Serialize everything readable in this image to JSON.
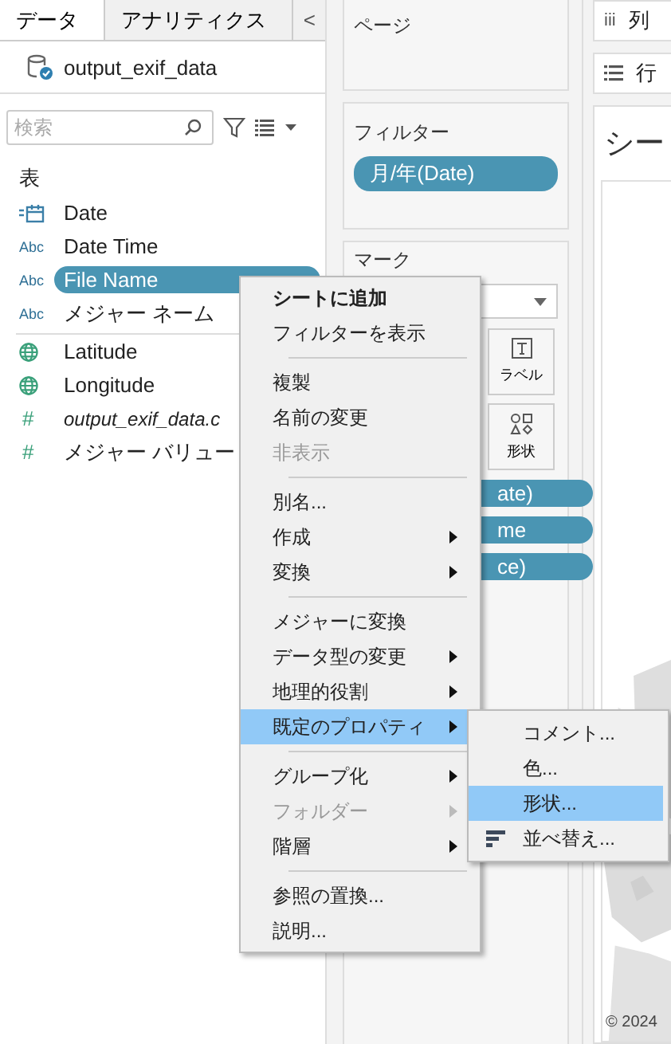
{
  "tabs": [
    {
      "label": "データ",
      "selected": true
    },
    {
      "label": "アナリティクス",
      "selected": false
    }
  ],
  "collapse_button": "<",
  "data_source": "output_exif_data",
  "search": {
    "placeholder": "検索"
  },
  "section_title": "表",
  "fields": [
    {
      "kind": "date",
      "name": "Date",
      "selected": false,
      "italic": false,
      "divider_before": false
    },
    {
      "kind": "string",
      "icon_text": "Abc",
      "name": "Date Time",
      "selected": false,
      "italic": false,
      "divider_before": false
    },
    {
      "kind": "string",
      "icon_text": "Abc",
      "name": "File Name",
      "selected": true,
      "italic": false,
      "divider_before": false
    },
    {
      "kind": "string",
      "icon_text": "Abc",
      "name": "メジャー ネーム",
      "selected": false,
      "italic": false,
      "divider_before": false
    },
    {
      "kind": "geo",
      "name": "Latitude",
      "selected": false,
      "italic": false,
      "divider_before": true
    },
    {
      "kind": "geo",
      "name": "Longitude",
      "selected": false,
      "italic": false,
      "divider_before": false
    },
    {
      "kind": "number",
      "icon_text": "#",
      "name": "output_exif_data.c",
      "selected": false,
      "italic": true,
      "divider_before": false
    },
    {
      "kind": "number",
      "icon_text": "#",
      "name": "メジャー バリュー",
      "selected": false,
      "italic": false,
      "divider_before": false
    }
  ],
  "pages_card": {
    "title": "ページ"
  },
  "filters_card": {
    "title": "フィルター",
    "pills": [
      "月/年(Date)"
    ]
  },
  "marks_card": {
    "title": "マーク",
    "buttons": [
      {
        "kind": "label",
        "label": "ラベル"
      },
      {
        "kind": "shape",
        "label": "形状"
      }
    ],
    "pills": [
      "ate)",
      "me",
      "ce)"
    ]
  },
  "columns_shelf": {
    "icon": "iii",
    "label": "列"
  },
  "rows_shelf": {
    "label": "行"
  },
  "sheet": {
    "title": "シー",
    "copyright": "© 2024"
  },
  "context_menu": [
    {
      "kind": "item",
      "label": "シートに追加",
      "bold": true,
      "disabled": false,
      "submenu": false,
      "selected": false
    },
    {
      "kind": "item",
      "label": "フィルターを表示",
      "bold": false,
      "disabled": false,
      "submenu": false,
      "selected": false
    },
    {
      "kind": "separator"
    },
    {
      "kind": "item",
      "label": "複製",
      "bold": false,
      "disabled": false,
      "submenu": false,
      "selected": false
    },
    {
      "kind": "item",
      "label": "名前の変更",
      "bold": false,
      "disabled": false,
      "submenu": false,
      "selected": false
    },
    {
      "kind": "item",
      "label": "非表示",
      "bold": false,
      "disabled": true,
      "submenu": false,
      "selected": false
    },
    {
      "kind": "separator"
    },
    {
      "kind": "item",
      "label": "別名...",
      "bold": false,
      "disabled": false,
      "submenu": false,
      "selected": false
    },
    {
      "kind": "item",
      "label": "作成",
      "bold": false,
      "disabled": false,
      "submenu": true,
      "selected": false
    },
    {
      "kind": "item",
      "label": "変換",
      "bold": false,
      "disabled": false,
      "submenu": true,
      "selected": false
    },
    {
      "kind": "separator"
    },
    {
      "kind": "item",
      "label": "メジャーに変換",
      "bold": false,
      "disabled": false,
      "submenu": false,
      "selected": false
    },
    {
      "kind": "item",
      "label": "データ型の変更",
      "bold": false,
      "disabled": false,
      "submenu": true,
      "selected": false
    },
    {
      "kind": "item",
      "label": "地理的役割",
      "bold": false,
      "disabled": false,
      "submenu": true,
      "selected": false
    },
    {
      "kind": "item",
      "label": "既定のプロパティ",
      "bold": false,
      "disabled": false,
      "submenu": true,
      "selected": true
    },
    {
      "kind": "separator"
    },
    {
      "kind": "item",
      "label": "グループ化",
      "bold": false,
      "disabled": false,
      "submenu": true,
      "selected": false
    },
    {
      "kind": "item",
      "label": "フォルダー",
      "bold": false,
      "disabled": true,
      "submenu": true,
      "selected": false
    },
    {
      "kind": "item",
      "label": "階層",
      "bold": false,
      "disabled": false,
      "submenu": true,
      "selected": false
    },
    {
      "kind": "separator"
    },
    {
      "kind": "item",
      "label": "参照の置換...",
      "bold": false,
      "disabled": false,
      "submenu": false,
      "selected": false
    },
    {
      "kind": "item",
      "label": "説明...",
      "bold": false,
      "disabled": false,
      "submenu": false,
      "selected": false
    }
  ],
  "submenu": [
    {
      "kind": "plain",
      "label": "コメント...",
      "selected": false
    },
    {
      "kind": "plain",
      "label": "色...",
      "selected": false
    },
    {
      "kind": "plain",
      "label": "形状...",
      "selected": true
    },
    {
      "kind": "sort",
      "label": "並べ替え...",
      "selected": false
    }
  ]
}
